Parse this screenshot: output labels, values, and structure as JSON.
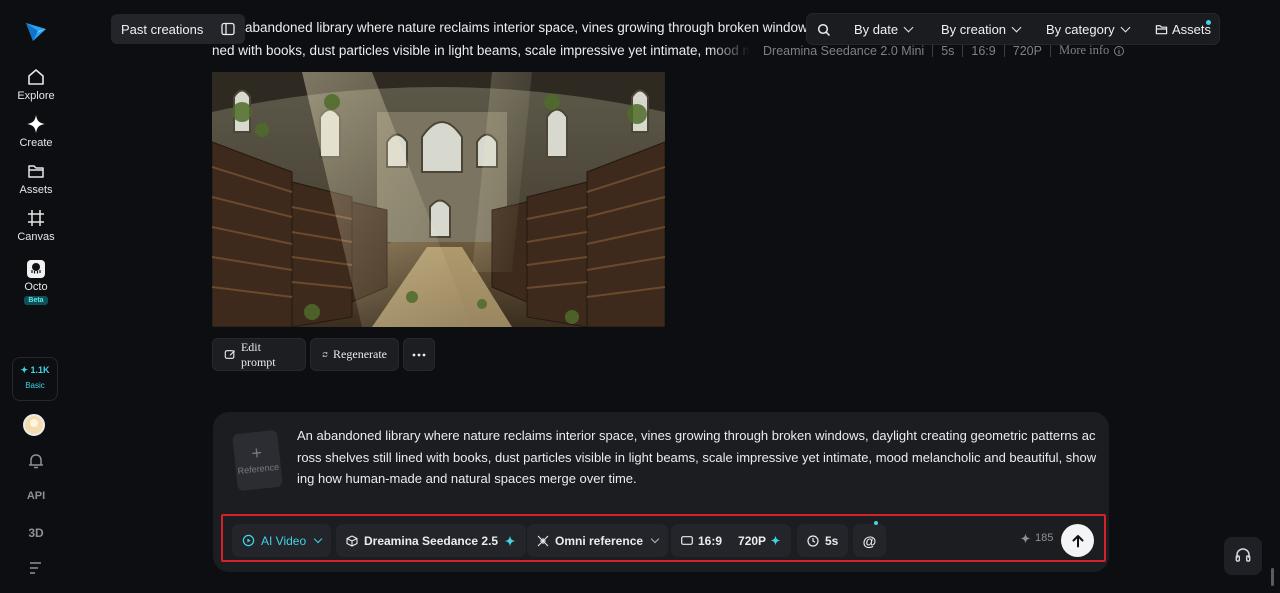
{
  "sidebar": {
    "items": [
      {
        "label": "Explore",
        "icon": "home-icon"
      },
      {
        "label": "Create",
        "icon": "sparkle-icon"
      },
      {
        "label": "Assets",
        "icon": "folder-icon"
      },
      {
        "label": "Canvas",
        "icon": "canvas-icon"
      },
      {
        "label": "Octo",
        "icon": "octo-icon",
        "badge": "Beta"
      }
    ],
    "credits": {
      "amount": "1.1K",
      "plan": "Basic"
    },
    "bottom": {
      "api_label": "API",
      "threed_label": "3D"
    }
  },
  "topbar": {
    "past_creations": "Past creations",
    "filters": [
      "By date",
      "By creation",
      "By category"
    ],
    "assets_label": "Assets"
  },
  "creation": {
    "prompt_line1": "abandoned library where nature reclaims interior space, vines growing through broken windows, daylight creating geometric patterns across",
    "prompt_line2": "ned with books, dust particles visible in light beams, scale impressive yet intimate, mood melancholic and beautiful",
    "model": "Dreamina Seedance 2.0 Mini",
    "duration": "5s",
    "ratio": "16:9",
    "resolution": "720P",
    "more_info": "More info",
    "actions": {
      "edit": "Edit prompt",
      "regenerate": "Regenerate"
    }
  },
  "composer": {
    "reference_label": "Reference",
    "prompt": "An abandoned library where nature reclaims interior space, vines growing through broken windows, daylight creating geometric patterns across shelves still lined with books, dust particles visible in light beams, scale impressive yet intimate, mood melancholic and beautiful, showing how human-made and natural spaces merge over time.",
    "toolbar": {
      "mode": "AI Video",
      "model": "Dreamina Seedance 2.5",
      "reference": "Omni reference",
      "ratio": "16:9",
      "resolution": "720P",
      "duration": "5s",
      "mention": "@",
      "cost": "185"
    }
  },
  "colors": {
    "accent": "#41d4e3",
    "background": "#0d0e11",
    "highlight_border": "#d6202a"
  }
}
